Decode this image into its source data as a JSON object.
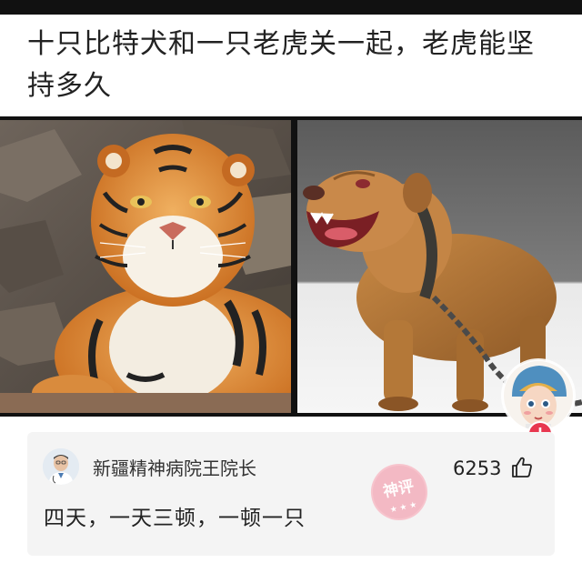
{
  "post": {
    "title": "十只比特犬和一只老虎关一起，老虎能坚持多久"
  },
  "media": {
    "images": [
      {
        "subject": "tiger"
      },
      {
        "subject": "pit-bull"
      }
    ]
  },
  "comment": {
    "author": "新疆精神病院王院长",
    "like_count": "6253",
    "text": "四天，一天三顿，一顿一只",
    "badge": "神评"
  },
  "colors": {
    "accent": "#e8374f",
    "stamp": "#f3a6b4"
  },
  "icons": {
    "like": "thumbs-up-icon",
    "follow": "plus-icon"
  }
}
